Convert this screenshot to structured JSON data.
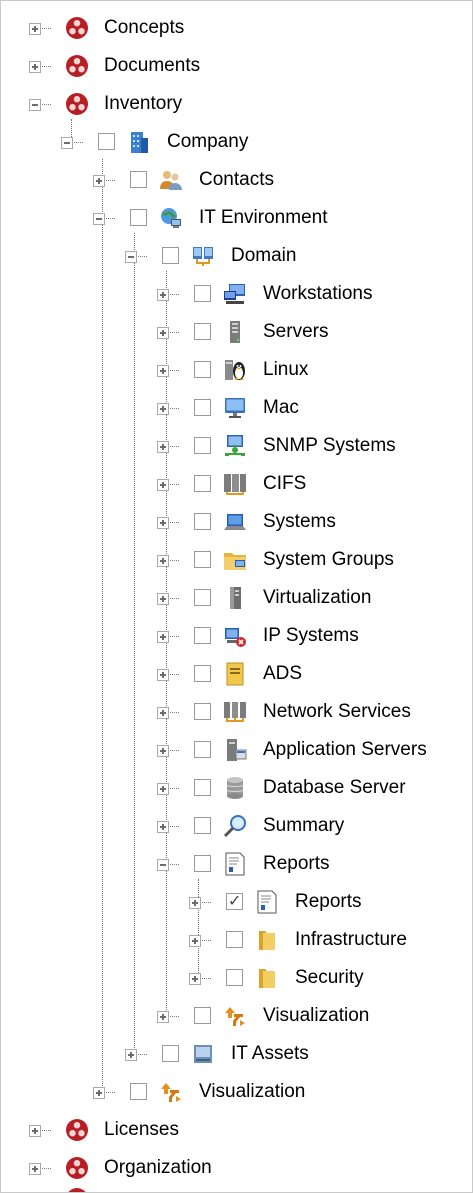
{
  "tree": {
    "concepts": "Concepts",
    "documents": "Documents",
    "inventory": "Inventory",
    "company": "Company",
    "contacts": "Contacts",
    "it_environment": "IT Environment",
    "domain": "Domain",
    "domain_children": [
      "Workstations",
      "Servers",
      "Linux",
      "Mac",
      "SNMP Systems",
      "CIFS",
      "Systems",
      "System Groups",
      "Virtualization",
      "IP Systems",
      "ADS",
      "Network Services",
      "Application Servers",
      "Database Server",
      "Summary"
    ],
    "reports": "Reports",
    "reports_children": [
      "Reports",
      "Infrastructure",
      "Security"
    ],
    "domain_visualization": "Visualization",
    "it_assets": "IT Assets",
    "company_visualization": "Visualization",
    "licenses": "Licenses",
    "organization": "Organization"
  }
}
